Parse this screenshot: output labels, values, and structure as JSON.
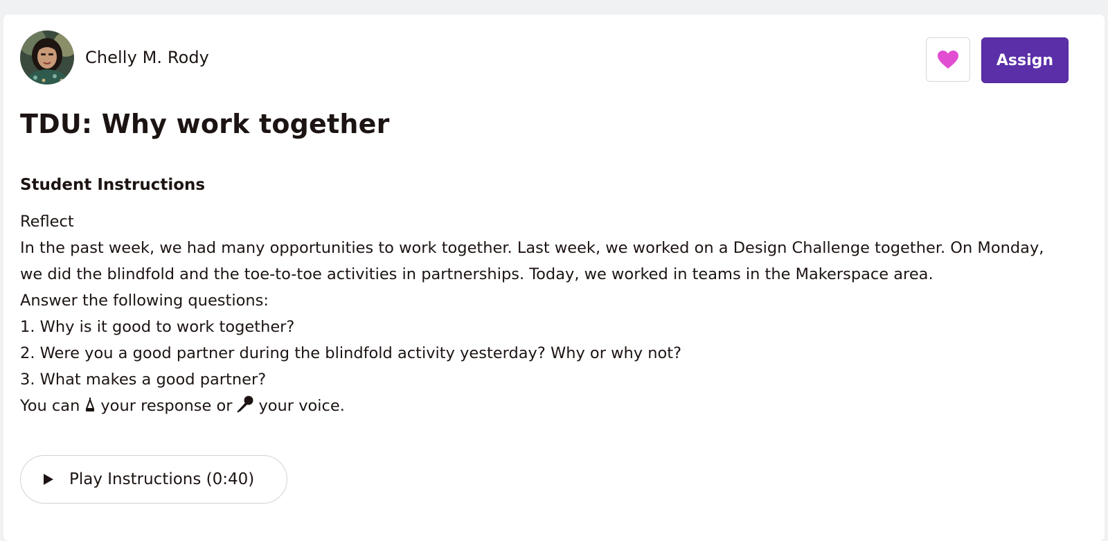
{
  "author": {
    "name": "Chelly M. Rody"
  },
  "actions": {
    "favorite_icon": "heart-icon",
    "assign_label": "Assign"
  },
  "activity": {
    "title": "TDU: Why work together"
  },
  "instructions": {
    "heading": "Student Instructions",
    "reflect": "Reflect",
    "paragraph": "In the past week, we had many opportunities to work together. Last week, we worked on a Design Challenge together. On Monday, we did the blindfold and the toe-to-toe activities in partnerships. Today, we worked in teams in the Makerspace area.",
    "prompt": "Answer the following questions:",
    "questions": [
      "1. Why is it good to work together?",
      "2. Were you a good partner during the blindfold activity yesterday? Why or why not?",
      "3. What makes a good partner?"
    ],
    "response_line": {
      "part1": "You can",
      "draw_icon": "pen-icon",
      "part2": "your response or",
      "mic_icon": "microphone-icon",
      "part3": "your voice."
    }
  },
  "play": {
    "label": "Play Instructions (0:40)",
    "icon": "play-icon"
  },
  "colors": {
    "accent": "#5b2fa8",
    "heart": "#e14ed1",
    "text": "#1c1412",
    "background": "#f0f1f3"
  }
}
